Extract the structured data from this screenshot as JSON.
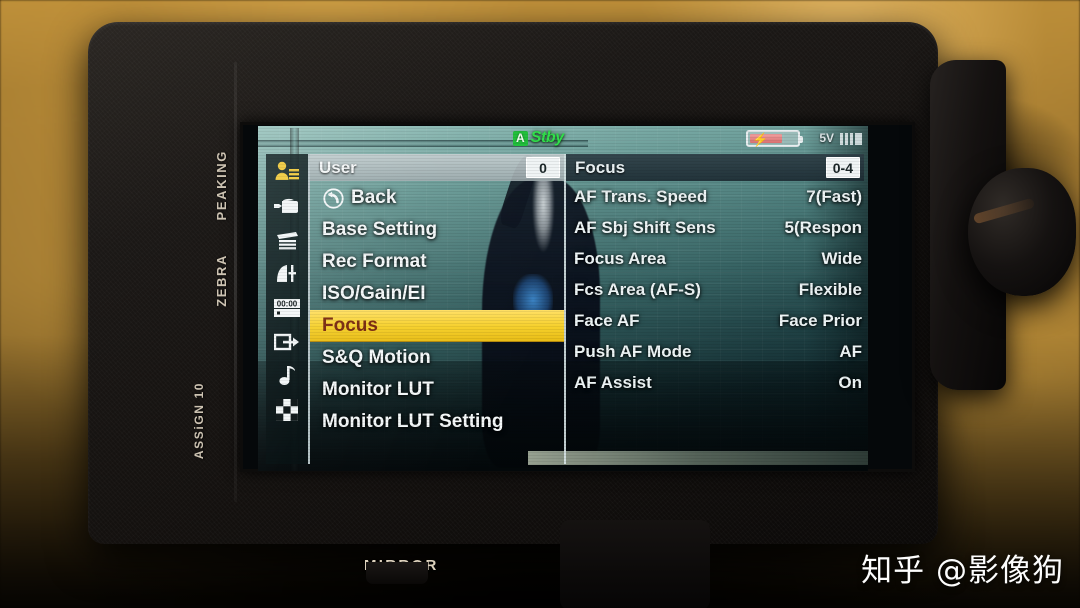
{
  "device": {
    "body_labels": {
      "peaking": "PEAKING",
      "zebra": "ZEBRA",
      "assign": "ASSiGN 10",
      "mirror": "MIRROR"
    }
  },
  "status_bar": {
    "rec_badge": "A",
    "rec_status": "Stby",
    "voltage": "5V",
    "battery_level": "70"
  },
  "menu": {
    "icon_rail": [
      {
        "name": "user-icon",
        "label": "User",
        "active": true
      },
      {
        "name": "camera-icon",
        "label": "Camera",
        "active": false
      },
      {
        "name": "slate-icon",
        "label": "Slate",
        "active": false
      },
      {
        "name": "paint-curve-icon",
        "label": "Paint",
        "active": false
      },
      {
        "name": "timecode-icon",
        "label": "TC/Media",
        "active": false
      },
      {
        "name": "output-icon",
        "label": "Video Out",
        "active": false
      },
      {
        "name": "audio-note-icon",
        "label": "Audio",
        "active": false
      },
      {
        "name": "checkerboard-icon",
        "label": "Thumbnail",
        "active": false
      }
    ],
    "left_pane": {
      "title": "User",
      "badge": "0",
      "items": [
        {
          "label": "Back",
          "icon": "back-arrow-icon",
          "selected": false
        },
        {
          "label": "Base Setting",
          "icon": "",
          "selected": false
        },
        {
          "label": "Rec Format",
          "icon": "",
          "selected": false
        },
        {
          "label": "ISO/Gain/EI",
          "icon": "",
          "selected": false
        },
        {
          "label": "Focus",
          "icon": "",
          "selected": true
        },
        {
          "label": "S&Q Motion",
          "icon": "",
          "selected": false
        },
        {
          "label": "Monitor LUT",
          "icon": "",
          "selected": false
        },
        {
          "label": "Monitor LUT Setting",
          "icon": "",
          "selected": false
        }
      ]
    },
    "right_pane": {
      "title": "Focus",
      "badge": "0-4",
      "settings": [
        {
          "label": "AF Trans. Speed",
          "value": "7(Fast)"
        },
        {
          "label": "AF Sbj Shift Sens",
          "value": "5(Respon"
        },
        {
          "label": "Focus Area",
          "value": "Wide"
        },
        {
          "label": "Fcs Area (AF-S)",
          "value": "Flexible"
        },
        {
          "label": "Face AF",
          "value": "Face Prior"
        },
        {
          "label": "Push AF Mode",
          "value": "AF"
        },
        {
          "label": "AF Assist",
          "value": "On"
        }
      ]
    }
  },
  "watermark": {
    "text": "知乎 @影像狗"
  },
  "colors": {
    "highlight_bg": "#f6d02c",
    "highlight_text": "#7a2b10",
    "stby_green": "#2fe34a",
    "menu_text": "#f4f8f9",
    "backdrop_gold": "#c8983c"
  }
}
